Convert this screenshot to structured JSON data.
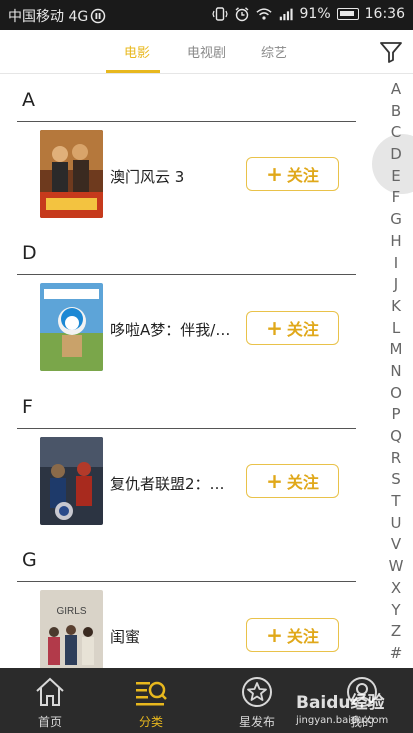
{
  "status_bar": {
    "carrier": "中国移动 4G",
    "battery": "91%",
    "time": "16:36"
  },
  "tabs": [
    {
      "label": "电影",
      "active": true
    },
    {
      "label": "电视剧",
      "active": false
    },
    {
      "label": "综艺",
      "active": false
    }
  ],
  "sections": [
    {
      "letter": "A",
      "items": [
        {
          "title": "澳门风云 3",
          "follow": "关注"
        }
      ]
    },
    {
      "letter": "D",
      "items": [
        {
          "title": "哆啦A梦：伴我/…",
          "follow": "关注"
        }
      ]
    },
    {
      "letter": "F",
      "items": [
        {
          "title": "复仇者联盟2：…",
          "follow": "关注"
        }
      ]
    },
    {
      "letter": "G",
      "items": [
        {
          "title": "闺蜜",
          "follow": "关注"
        }
      ]
    }
  ],
  "poster_text": {
    "g": "GIRLS"
  },
  "alphabet": [
    "A",
    "B",
    "C",
    "D",
    "E",
    "F",
    "G",
    "H",
    "I",
    "J",
    "K",
    "L",
    "M",
    "N",
    "O",
    "P",
    "Q",
    "R",
    "S",
    "T",
    "U",
    "V",
    "W",
    "X",
    "Y",
    "Z",
    "#"
  ],
  "bottom_nav": [
    {
      "label": "首页",
      "icon": "home-icon",
      "active": false
    },
    {
      "label": "分类",
      "icon": "category-search-icon",
      "active": true
    },
    {
      "label": "星发布",
      "icon": "star-icon",
      "active": false
    },
    {
      "label": "我的",
      "icon": "profile-icon",
      "active": false
    }
  ],
  "watermark": {
    "main": "Baidu经验",
    "sub": "jingyan.baidu.com"
  },
  "colors": {
    "accent": "#e8b81e",
    "nav_bg": "#2b2b2b",
    "status_bg": "#1a1a1a"
  }
}
